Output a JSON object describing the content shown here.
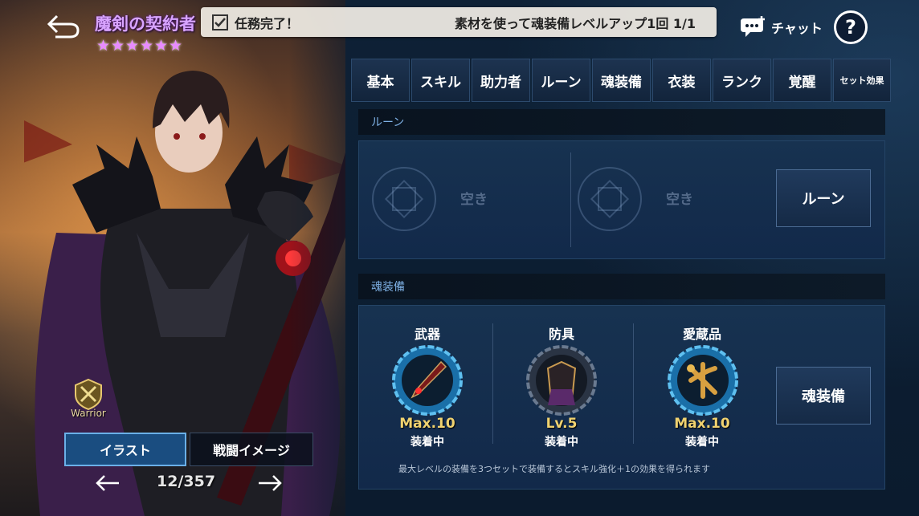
{
  "header": {
    "title": "魔剣の契約者",
    "stars": 6
  },
  "task_banner": {
    "done_label": "任務完了！",
    "detail": "素材を使って魂装備レベルアップ1回 1/1"
  },
  "chat_label": "チャット",
  "help_label": "?",
  "tabs": [
    {
      "label": "基本"
    },
    {
      "label": "スキル"
    },
    {
      "label": "助力者"
    },
    {
      "label": "ルーン"
    },
    {
      "label": "魂装備"
    },
    {
      "label": "衣装"
    },
    {
      "label": "ランク"
    },
    {
      "label": "覚醒"
    },
    {
      "label": "セット効果"
    }
  ],
  "rune_section": {
    "heading": "ルーン",
    "slot1_label": "空き",
    "slot2_label": "空き",
    "button_label": "ルーン"
  },
  "soul_section": {
    "heading": "魂装備",
    "items": [
      {
        "name": "武器",
        "level": "Max.10",
        "status": "装着中"
      },
      {
        "name": "防具",
        "level": "Lv.5",
        "status": "装着中"
      },
      {
        "name": "愛蔵品",
        "level": "Max.10",
        "status": "装着中"
      }
    ],
    "button_label": "魂装備",
    "note": "最大レベルの装備を3つセットで装備するとスキル強化＋1の効果を得られます"
  },
  "character": {
    "class_label": "Warrior",
    "illust_button": "イラスト",
    "battle_button": "戦闘イメージ",
    "page_count": "12/357"
  },
  "colors": {
    "title": "#d8a4ff",
    "level": "#f0d270",
    "accent_blue": "#1a4d80"
  }
}
